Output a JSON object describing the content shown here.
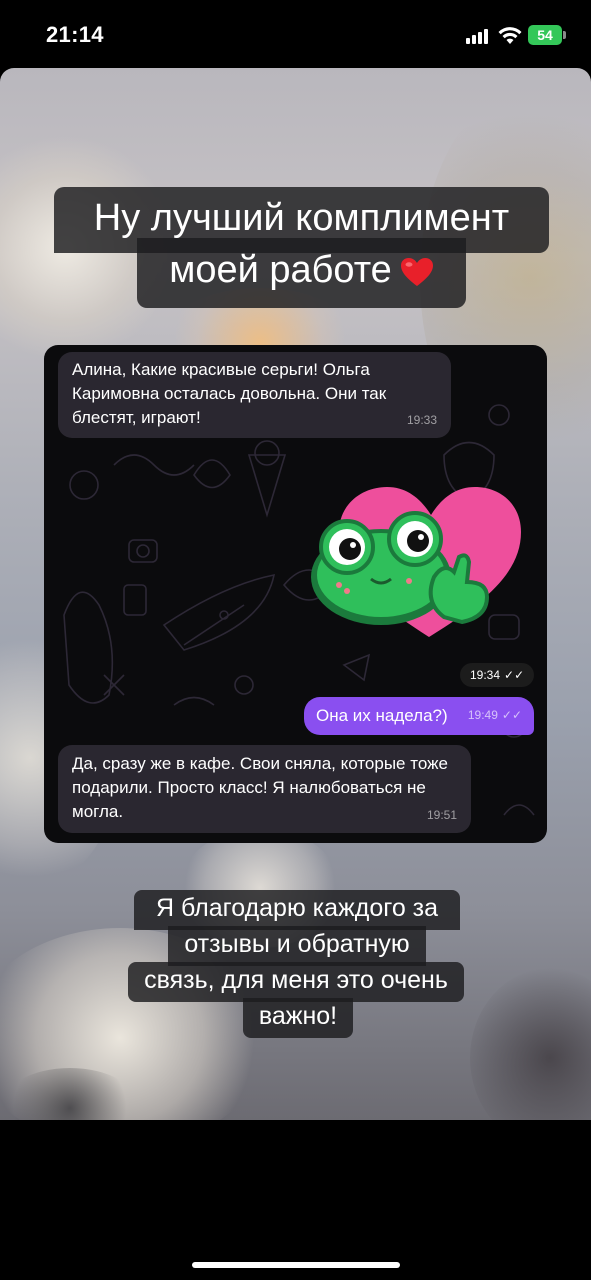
{
  "status_bar": {
    "time": "21:14",
    "battery_level": "54",
    "icons": [
      "signal-icon",
      "wifi-icon",
      "battery-icon"
    ]
  },
  "story": {
    "caption_top_line1": "Ну лучший комплимент",
    "caption_top_line2": "моей работе",
    "caption_bottom_lines": [
      "Я благодарю каждого за",
      "отзывы и обратную",
      "связь, для меня это очень",
      "важно!"
    ]
  },
  "chat": {
    "messages": [
      {
        "direction": "incoming",
        "text": "Алина, Какие красивые серьги! Ольга Каримовна осталась довольна. Они так блестят, играют!",
        "time": "19:33"
      },
      {
        "direction": "outgoing",
        "type": "sticker",
        "sticker": "frog-heart-thumbs-up",
        "time": "19:34"
      },
      {
        "direction": "outgoing",
        "text": "Она их надела?)",
        "time": "19:49"
      },
      {
        "direction": "incoming",
        "text": "Да, сразу же в кафе. Свои сняла, которые тоже подарили. Просто класс! Я налюбоваться не могла.",
        "time": "19:51"
      }
    ]
  },
  "colors": {
    "outgoing_bubble": "#8a4ff0",
    "incoming_bubble": "#2a2730",
    "chat_background": "#0b0b0d",
    "battery": "#34c759",
    "heart": "#ee4f9c",
    "frog": "#2fbf5b"
  }
}
